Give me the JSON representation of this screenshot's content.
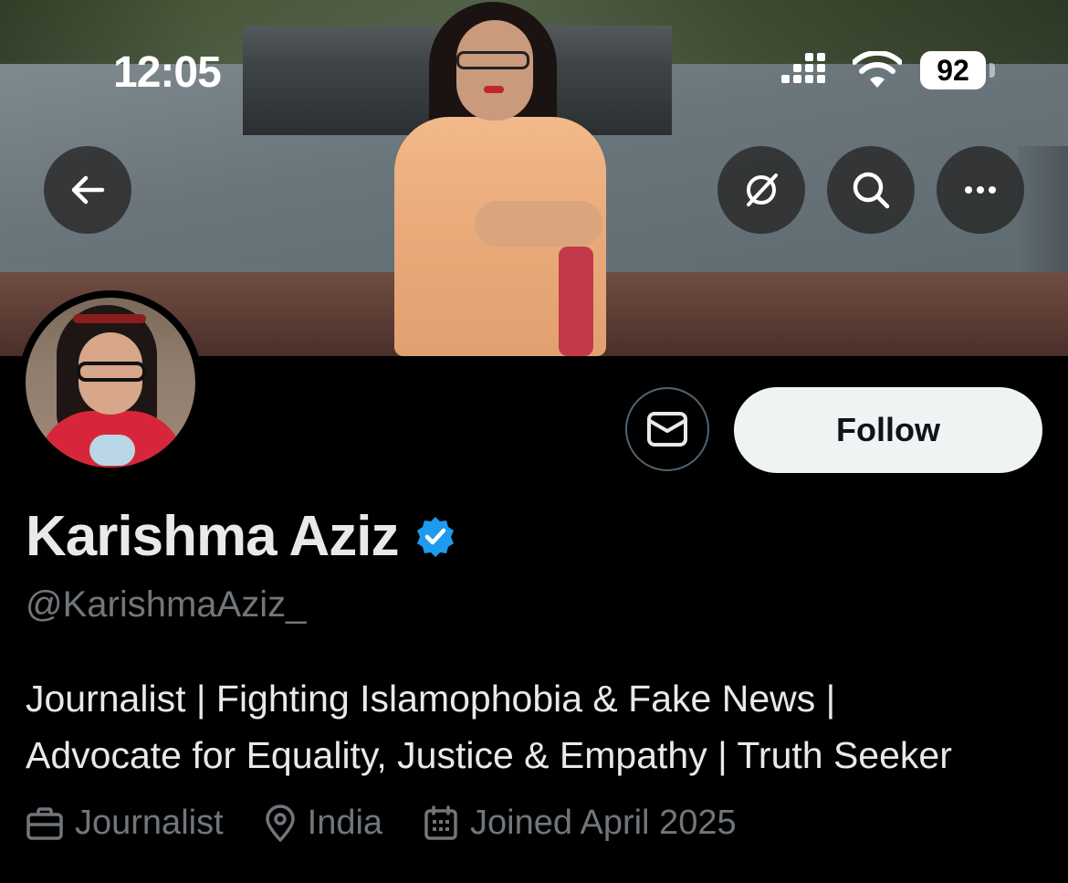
{
  "status_bar": {
    "time": "12:05",
    "battery": "92"
  },
  "header_icons": {
    "back": "arrow-left-icon",
    "grok": "grok-slash-icon",
    "search": "search-icon",
    "more": "more-horizontal-icon"
  },
  "profile": {
    "name": "Karishma Aziz",
    "handle": "@KarishmaAziz_",
    "bio_line1": "Journalist | Fighting Islamophobia & Fake News |",
    "bio_line2": "Advocate for Equality, Justice & Empathy | Truth Seeker",
    "verified_color": "#1d9bf0"
  },
  "actions": {
    "follow_label": "Follow",
    "message_icon": "envelope-icon"
  },
  "meta": {
    "profession": "Journalist",
    "location": "India",
    "joined": "Joined April 2025"
  },
  "colors": {
    "accent": "#1d9bf0",
    "muted": "#71767b",
    "background": "#000000"
  }
}
